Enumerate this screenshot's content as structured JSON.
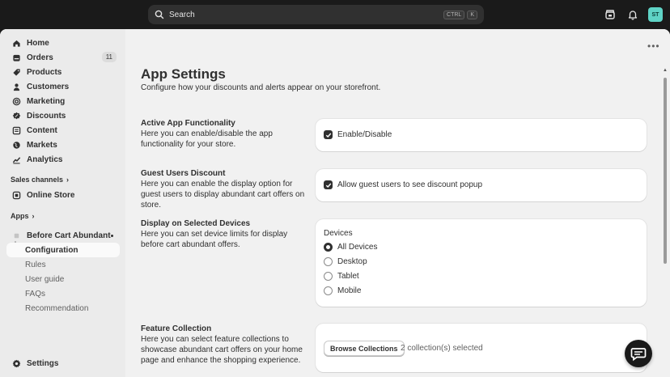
{
  "topbar": {
    "search_placeholder": "Search",
    "shortcut_ctrl": "CTRL",
    "shortcut_k": "K",
    "avatar_initials": "ST"
  },
  "sidebar": {
    "items": [
      {
        "label": "Home",
        "icon": "home-icon"
      },
      {
        "label": "Orders",
        "icon": "orders-icon",
        "count": "11"
      },
      {
        "label": "Products",
        "icon": "tag-icon"
      },
      {
        "label": "Customers",
        "icon": "person-icon"
      },
      {
        "label": "Marketing",
        "icon": "target-icon"
      },
      {
        "label": "Discounts",
        "icon": "discount-icon"
      },
      {
        "label": "Content",
        "icon": "content-icon"
      },
      {
        "label": "Markets",
        "icon": "globe-icon"
      },
      {
        "label": "Analytics",
        "icon": "analytics-icon"
      }
    ],
    "sales_channels_label": "Sales channels",
    "online_store_label": "Online Store",
    "apps_label": "Apps",
    "app_name": "Before Cart Abundant",
    "app_subitems": [
      "Configuration",
      "Rules",
      "User guide",
      "FAQs",
      "Recommendation"
    ],
    "settings_label": "Settings"
  },
  "main": {
    "title": "App Settings",
    "subtitle": "Configure how your discounts and alerts appear on your storefront.",
    "sections": [
      {
        "heading": "Active App Functionality",
        "description": "Here you can enable/disable the app functionality for your store.",
        "checkbox_label": "Enable/Disable",
        "checked": true
      },
      {
        "heading": "Guest Users Discount",
        "description": "Here you can enable the display option for guest users to display abundant cart offers on store.",
        "checkbox_label": "Allow guest users to see discount popup",
        "checked": true
      },
      {
        "heading": "Display on Selected Devices",
        "description": "Here you can set device limits for display before cart abundant offers.",
        "group_label": "Devices",
        "options": [
          "All Devices",
          "Desktop",
          "Tablet",
          "Mobile"
        ],
        "selected": "All Devices"
      },
      {
        "heading": "Feature Collection",
        "description": "Here you can select feature collections to showcase abundant cart offers on your home page and enhance the shopping experience.",
        "button_label": "Browse Collections",
        "selection_text": "2 collection(s) selected"
      }
    ]
  },
  "colors": {
    "topbar_bg": "#1a1a1a",
    "page_bg": "#f1f1f1",
    "sidebar_bg": "#ebebeb",
    "card_bg": "#ffffff",
    "avatar_bg": "#5fd3c6"
  }
}
